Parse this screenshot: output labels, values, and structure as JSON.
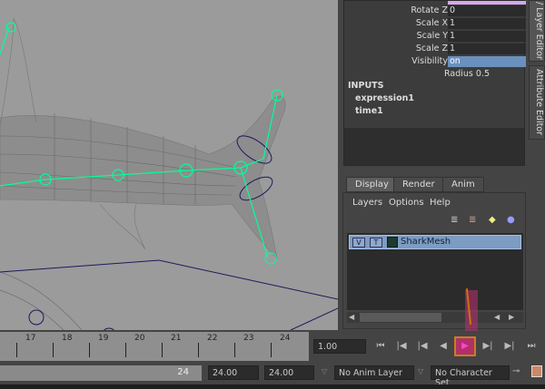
{
  "attribute_editor": {
    "rows": [
      {
        "label": "Rotate Z",
        "value": "0"
      },
      {
        "label": "Scale X",
        "value": "1"
      },
      {
        "label": "Scale Y",
        "value": "1"
      },
      {
        "label": "Scale Z",
        "value": "1"
      },
      {
        "label": "Visibility",
        "value": "on"
      }
    ],
    "radius": "Radius 0.5",
    "inputs_header": "INPUTS",
    "inputs": [
      "expression1",
      "time1"
    ]
  },
  "side_tabs": {
    "layer_editor": "/ Layer Editor",
    "attribute_editor": "Attribute Editor"
  },
  "layer_editor": {
    "tabs": [
      "Display",
      "Render",
      "Anim"
    ],
    "menus": [
      "Layers",
      "Options",
      "Help"
    ],
    "layer": {
      "v": "V",
      "t": "T",
      "name": "SharkMesh"
    }
  },
  "timeline": {
    "ticks": [
      "17",
      "18",
      "19",
      "20",
      "21",
      "22",
      "23",
      "24"
    ],
    "current_time": "1.00"
  },
  "range": {
    "end_frame": "24",
    "start_field": "24.00",
    "end_field": "24.00",
    "anim_layer": "No Anim Layer",
    "character_set": "No Character Set"
  },
  "colors": {
    "accent": "#7e9bc2",
    "rig": "#00ff99",
    "highlight": "#b0306a"
  }
}
